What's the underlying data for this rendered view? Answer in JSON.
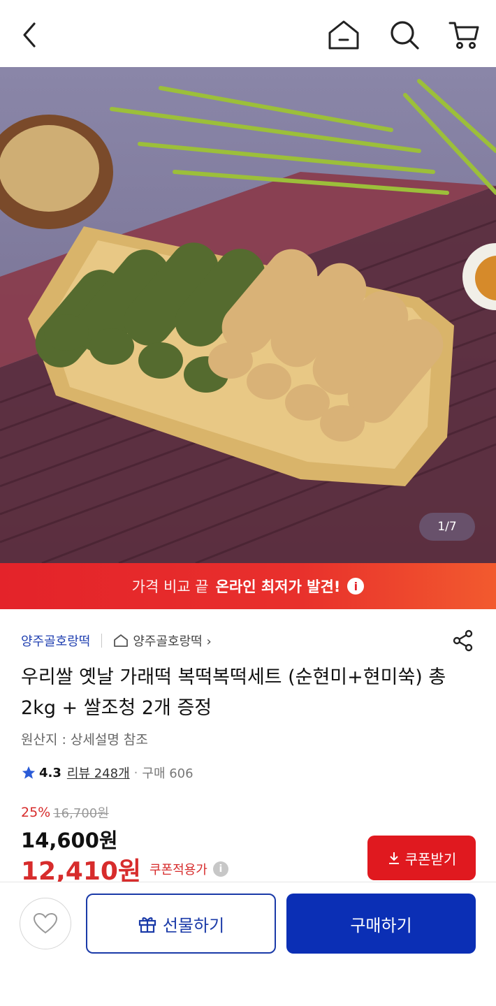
{
  "product_image": {
    "pager": "1/7",
    "alt": "product-photo"
  },
  "banner": {
    "text_light": "가격 비교 끝",
    "text_bold": "온라인 최저가 발견!",
    "info_glyph": "i"
  },
  "seller": {
    "name": "양주골호랑떡",
    "store_link": "양주골호랑떡 ›"
  },
  "product": {
    "title": "우리쌀 옛날 가래떡 복떡복떡세트 (순현미+현미쑥) 총 2kg  + 쌀조청 2개 증정",
    "origin": "원산지 : 상세설명 참조",
    "rating": "4.3",
    "review_link": "리뷰 248개",
    "separator": "·",
    "buy_count": "구매 606",
    "discount": "25%",
    "original_price": "16,700원",
    "sale_price": "14,600원",
    "coupon_price": "12,410원",
    "coupon_price_label": "쿠폰적용가",
    "coupon_info_glyph": "i"
  },
  "actions": {
    "coupon_button": "쿠폰받기",
    "gift_button": "선물하기",
    "buy_button": "구매하기"
  },
  "icons": {
    "back": "chevron-left-icon",
    "home": "home-icon",
    "search": "search-icon",
    "cart": "cart-icon",
    "share": "share-icon",
    "star": "star-icon",
    "heart": "heart-icon",
    "gift": "gift-icon",
    "download": "download-icon"
  },
  "colors": {
    "banner_red": "#e4232a",
    "price_red": "#d72c2c",
    "brand_blue": "#0b2fb5",
    "seller_blue": "#1f3fb0"
  }
}
